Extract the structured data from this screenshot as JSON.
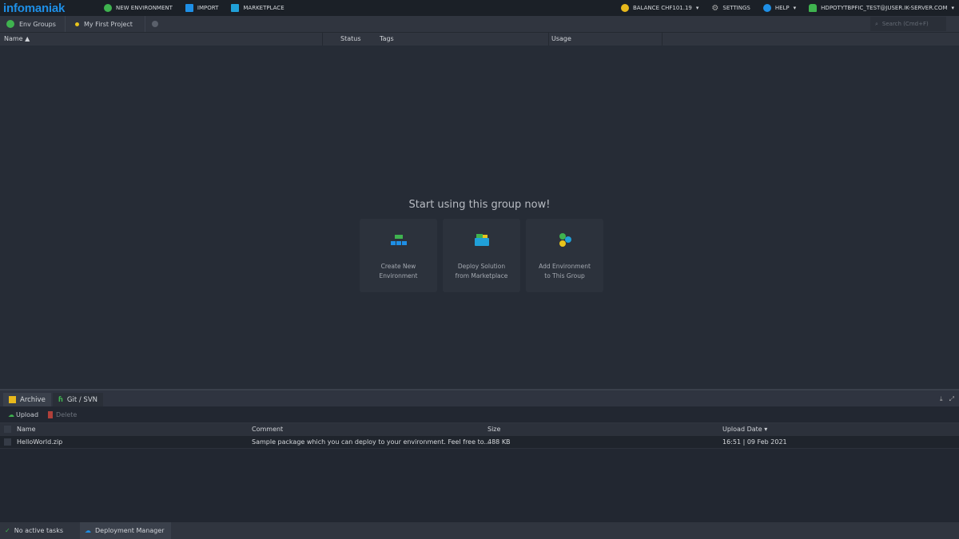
{
  "topbar": {
    "logo": "infomaniak",
    "new_environment": "NEW ENVIRONMENT",
    "import": "IMPORT",
    "marketplace": "MARKETPLACE",
    "balance": "BALANCE CHF101.19",
    "settings": "SETTINGS",
    "help": "HELP",
    "user": "HDPOTYTBPFIC_TEST@JUSER.IK-SERVER.COM"
  },
  "breadcrumb": {
    "env_groups": "Env Groups",
    "project": "My First Project"
  },
  "search": {
    "placeholder": "Search (Cmd+F)"
  },
  "table": {
    "columns": {
      "name": "Name ▲",
      "status": "Status",
      "tags": "Tags",
      "usage": "Usage"
    }
  },
  "empty": {
    "title": "Start using this group now!",
    "cards": [
      {
        "line1": "Create New",
        "line2": "Environment"
      },
      {
        "line1": "Deploy Solution",
        "line2": "from Marketplace"
      },
      {
        "line1": "Add Environment",
        "line2": "to This Group"
      }
    ]
  },
  "deploy": {
    "tabs": [
      "Archive",
      "Git / SVN"
    ],
    "upload": "Upload",
    "delete": "Delete",
    "columns": {
      "name": "Name",
      "comment": "Comment",
      "size": "Size",
      "date": "Upload Date ▾"
    },
    "rows": [
      {
        "name": "HelloWorld.zip",
        "comment": "Sample package which you can deploy to your environment. Feel free to...",
        "size": "488 KB",
        "date": "16:51 | 09 Feb 2021"
      }
    ]
  },
  "statusbar": {
    "tasks": "No active tasks",
    "manager": "Deployment Manager"
  }
}
